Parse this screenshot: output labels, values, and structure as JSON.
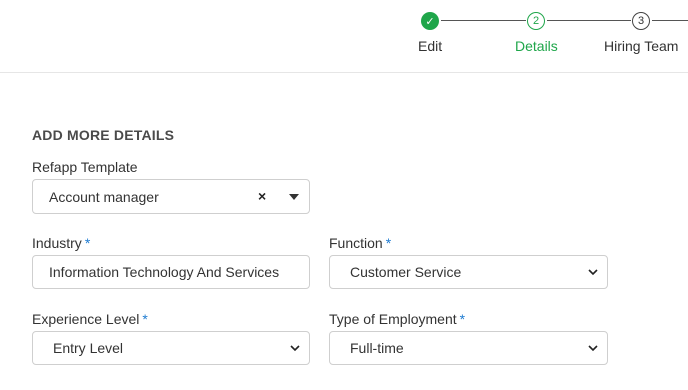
{
  "stepper": {
    "steps": [
      {
        "label": "Edit",
        "marker": "✓",
        "state": "complete"
      },
      {
        "label": "Details",
        "marker": "2",
        "state": "active"
      },
      {
        "label": "Hiring Team",
        "marker": "3",
        "state": "upcoming"
      }
    ]
  },
  "colors": {
    "accent_green": "#1fa64a",
    "required_blue": "#1e7bd1"
  },
  "form": {
    "section_title": "ADD MORE DETAILS",
    "template": {
      "label": "Refapp Template",
      "value": "Account manager",
      "clear_glyph": "×"
    },
    "industry": {
      "label": "Industry",
      "required_mark": "*",
      "value": "Information Technology And Services"
    },
    "function": {
      "label": "Function",
      "required_mark": "*",
      "value": "Customer Service"
    },
    "experience": {
      "label": "Experience Level",
      "required_mark": "*",
      "value": "Entry Level"
    },
    "employment_type": {
      "label": "Type of Employment",
      "required_mark": "*",
      "value": "Full-time"
    }
  }
}
